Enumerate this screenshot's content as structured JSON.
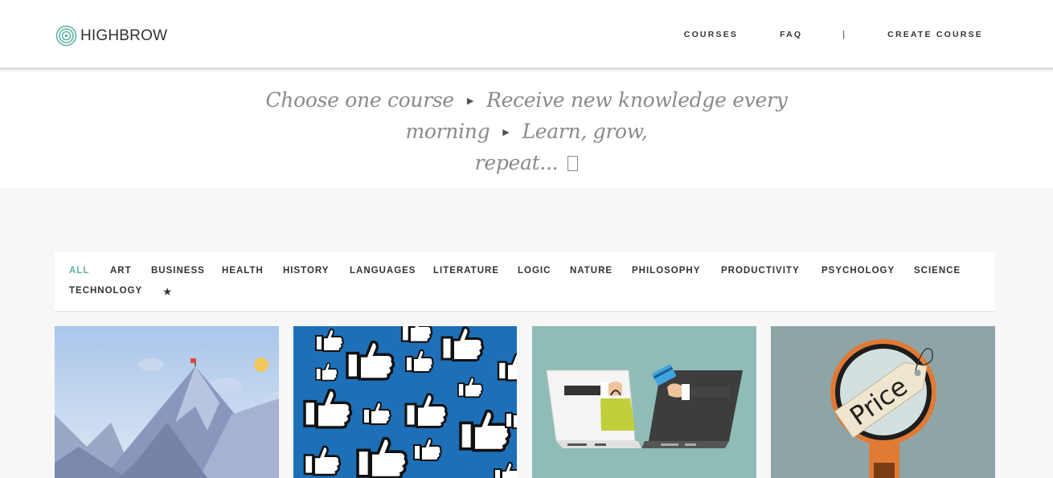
{
  "header": {
    "logo_text": "HIGHBROW",
    "nav": {
      "courses": "COURSES",
      "faq": "FAQ",
      "separator": "|",
      "create_course": "CREATE COURSE"
    }
  },
  "hero": {
    "step1": "Choose one course",
    "step2": "Receive new knowledge every morning",
    "step3": "Learn, grow,",
    "step4": "repeat...",
    "arrow_glyph": "▶"
  },
  "categories": [
    "ALL",
    "ART",
    "BUSINESS",
    "HEALTH",
    "HISTORY",
    "LANGUAGES",
    "LITERATURE",
    "LOGIC",
    "NATURE",
    "PHILOSOPHY",
    "PRODUCTIVITY",
    "PSYCHOLOGY",
    "SCIENCE",
    "TECHNOLOGY",
    "★"
  ],
  "active_category": "ALL",
  "cards": [
    {
      "image": "mountain-summit-flag"
    },
    {
      "image": "thumbs-up-pattern"
    },
    {
      "image": "laptops-online-shopping"
    },
    {
      "image": "magnifier-price-tag",
      "price_text": "Price"
    }
  ],
  "colors": {
    "accent": "#5fb3a5",
    "card_bg_blue": "#1d6fb8",
    "card_bg_teal": "#8fbcb5",
    "card_bg_slate": "#8ea5a8"
  }
}
